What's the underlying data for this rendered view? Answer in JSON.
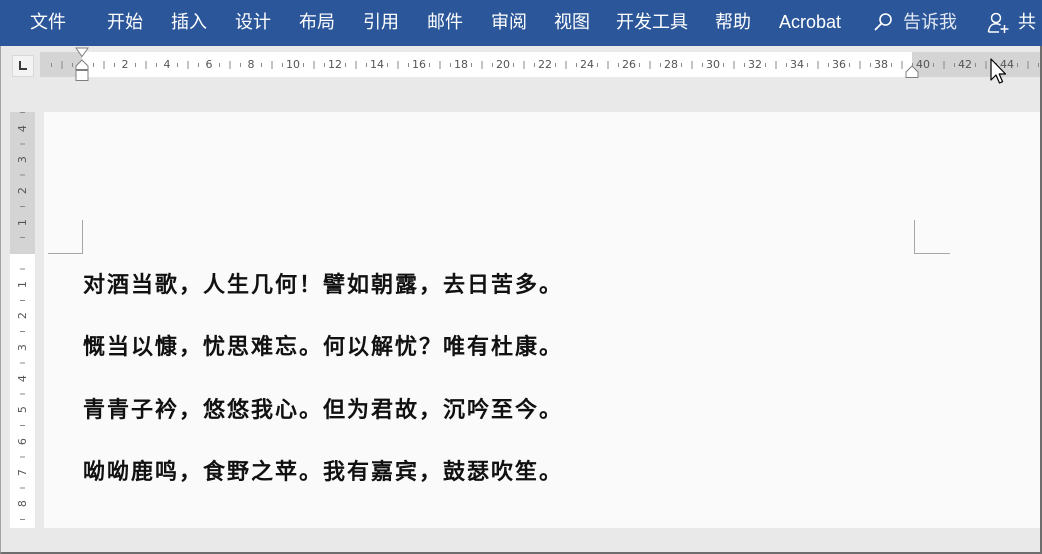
{
  "ribbon": {
    "tabs": [
      {
        "label": "文件"
      },
      {
        "label": "开始"
      },
      {
        "label": "插入"
      },
      {
        "label": "设计"
      },
      {
        "label": "布局"
      },
      {
        "label": "引用"
      },
      {
        "label": "邮件"
      },
      {
        "label": "审阅"
      },
      {
        "label": "视图"
      },
      {
        "label": "开发工具"
      },
      {
        "label": "帮助"
      },
      {
        "label": "Acrobat"
      }
    ],
    "tell_me": {
      "icon": "search-icon",
      "label": "告诉我"
    },
    "share": {
      "icon": "add-person-icon",
      "label": "共"
    }
  },
  "rulers": {
    "tab_selector": {
      "icon": "left-tab-icon"
    },
    "horizontal": {
      "labels": [
        "2",
        "4",
        "6",
        "8",
        "10",
        "12",
        "14",
        "16",
        "18",
        "20",
        "22",
        "24",
        "26",
        "28",
        "30",
        "32",
        "34",
        "36",
        "38",
        "40",
        "42",
        "44"
      ]
    },
    "vertical": {
      "labels_top_margin": [
        "4",
        "3",
        "2",
        "1"
      ],
      "labels_body": [
        "1",
        "2",
        "3",
        "4",
        "5",
        "6",
        "7",
        "8"
      ]
    }
  },
  "document": {
    "paragraphs": [
      "对酒当歌，人生几何！譬如朝露，去日苦多。",
      "慨当以慷，忧思难忘。何以解忧？唯有杜康。",
      "青青子衿，悠悠我心。但为君故，沉吟至今。",
      "呦呦鹿鸣，食野之苹。我有嘉宾，鼓瑟吹笙。"
    ]
  },
  "cursor": {
    "icon": "mouse-pointer-icon"
  },
  "colors": {
    "ribbon_background": "#2b579a",
    "ribbon_text": "#ffffff",
    "tell_me_text": "#e1e8f3",
    "workspace_background": "#e9e9e9",
    "ruler_margin": "#d4d4d4",
    "page_background": "#fafafa",
    "document_text": "#111111"
  }
}
